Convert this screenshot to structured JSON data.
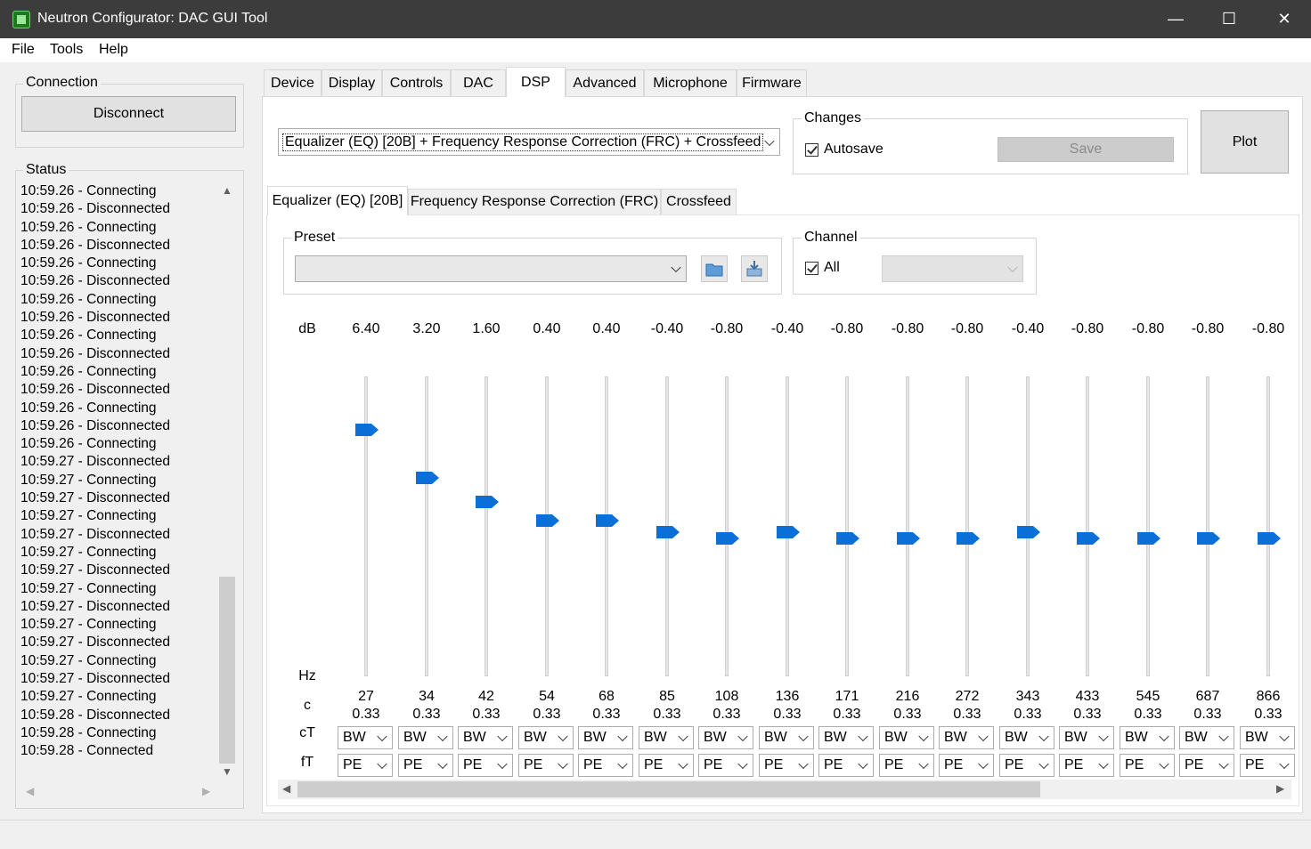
{
  "window": {
    "title": "Neutron Configurator: DAC GUI Tool",
    "min": "—",
    "max": "☐",
    "close": "✕"
  },
  "menu": [
    "File",
    "Tools",
    "Help"
  ],
  "connection": {
    "label": "Connection",
    "button": "Disconnect"
  },
  "status": {
    "label": "Status",
    "lines": [
      "10:59.26 - Connecting",
      "10:59.26 - Disconnected",
      "10:59.26 - Connecting",
      "10:59.26 - Disconnected",
      "10:59.26 - Connecting",
      "10:59.26 - Disconnected",
      "10:59.26 - Connecting",
      "10:59.26 - Disconnected",
      "10:59.26 - Connecting",
      "10:59.26 - Disconnected",
      "10:59.26 - Connecting",
      "10:59.26 - Disconnected",
      "10:59.26 - Connecting",
      "10:59.26 - Disconnected",
      "10:59.26 - Connecting",
      "10:59.27 - Disconnected",
      "10:59.27 - Connecting",
      "10:59.27 - Disconnected",
      "10:59.27 - Connecting",
      "10:59.27 - Disconnected",
      "10:59.27 - Connecting",
      "10:59.27 - Disconnected",
      "10:59.27 - Connecting",
      "10:59.27 - Disconnected",
      "10:59.27 - Connecting",
      "10:59.27 - Disconnected",
      "10:59.27 - Connecting",
      "10:59.27 - Disconnected",
      "10:59.27 - Connecting",
      "10:59.28 - Disconnected",
      "10:59.28 - Connecting",
      "10:59.28 - Connected"
    ]
  },
  "tabs": [
    "Device",
    "Display",
    "Controls",
    "DAC",
    "DSP",
    "Advanced",
    "Microphone",
    "Firmware"
  ],
  "active_tab": "DSP",
  "dsp": {
    "mode_select": "Equalizer (EQ) [20B] + Frequency Response Correction (FRC) + Crossfeed",
    "changes": {
      "label": "Changes",
      "autosave": "Autosave",
      "save": "Save"
    },
    "plot": "Plot",
    "subtabs": [
      "Equalizer (EQ) [20B]",
      "Frequency Response Correction (FRC)",
      "Crossfeed"
    ],
    "preset": {
      "label": "Preset",
      "value": ""
    },
    "channel": {
      "label": "Channel",
      "all": "All",
      "value": ""
    }
  },
  "eq": {
    "labels": {
      "db": "dB",
      "hz": "Hz",
      "c": "c",
      "ct": "cT",
      "ft": "fT"
    },
    "bands": [
      {
        "db": "6.40",
        "gain": 6.4,
        "hz": "27",
        "c": "0.33",
        "ct": "BW",
        "ft": "PE"
      },
      {
        "db": "3.20",
        "gain": 3.2,
        "hz": "34",
        "c": "0.33",
        "ct": "BW",
        "ft": "PE"
      },
      {
        "db": "1.60",
        "gain": 1.6,
        "hz": "42",
        "c": "0.33",
        "ct": "BW",
        "ft": "PE"
      },
      {
        "db": "0.40",
        "gain": 0.4,
        "hz": "54",
        "c": "0.33",
        "ct": "BW",
        "ft": "PE"
      },
      {
        "db": "0.40",
        "gain": 0.4,
        "hz": "68",
        "c": "0.33",
        "ct": "BW",
        "ft": "PE"
      },
      {
        "db": "-0.40",
        "gain": -0.4,
        "hz": "85",
        "c": "0.33",
        "ct": "BW",
        "ft": "PE"
      },
      {
        "db": "-0.80",
        "gain": -0.8,
        "hz": "108",
        "c": "0.33",
        "ct": "BW",
        "ft": "PE"
      },
      {
        "db": "-0.40",
        "gain": -0.4,
        "hz": "136",
        "c": "0.33",
        "ct": "BW",
        "ft": "PE"
      },
      {
        "db": "-0.80",
        "gain": -0.8,
        "hz": "171",
        "c": "0.33",
        "ct": "BW",
        "ft": "PE"
      },
      {
        "db": "-0.80",
        "gain": -0.8,
        "hz": "216",
        "c": "0.33",
        "ct": "BW",
        "ft": "PE"
      },
      {
        "db": "-0.80",
        "gain": -0.8,
        "hz": "272",
        "c": "0.33",
        "ct": "BW",
        "ft": "PE"
      },
      {
        "db": "-0.40",
        "gain": -0.4,
        "hz": "343",
        "c": "0.33",
        "ct": "BW",
        "ft": "PE"
      },
      {
        "db": "-0.80",
        "gain": -0.8,
        "hz": "433",
        "c": "0.33",
        "ct": "BW",
        "ft": "PE"
      },
      {
        "db": "-0.80",
        "gain": -0.8,
        "hz": "545",
        "c": "0.33",
        "ct": "BW",
        "ft": "PE"
      },
      {
        "db": "-0.80",
        "gain": -0.8,
        "hz": "687",
        "c": "0.33",
        "ct": "BW",
        "ft": "PE"
      },
      {
        "db": "-0.80",
        "gain": -0.8,
        "hz": "866",
        "c": "0.33",
        "ct": "BW",
        "ft": "PE"
      }
    ]
  },
  "colors": {
    "slider_thumb": "#0a6fd6",
    "titlebar": "#3c3c3c"
  }
}
